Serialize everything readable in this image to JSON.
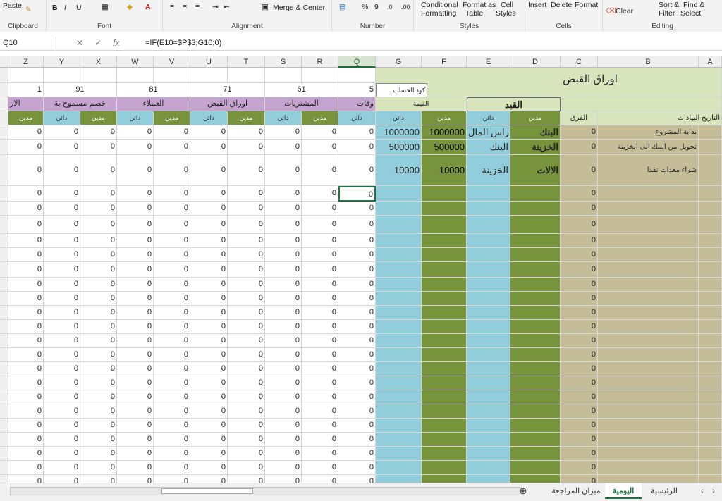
{
  "ribbon": {
    "clipboard": {
      "paste": "Paste",
      "label": "Clipboard"
    },
    "font": {
      "bold": "B",
      "italic": "I",
      "underline": "U",
      "label": "Font"
    },
    "alignment": {
      "merge": "Merge & Center",
      "label": "Alignment"
    },
    "number": {
      "percent": "%",
      "comma": "9",
      "label": "Number"
    },
    "styles": {
      "cond1": "Conditional",
      "cond2": "Formatting",
      "fmt1": "Format as",
      "fmt2": "Table",
      "cs1": "Cell",
      "cs2": "Styles",
      "label": "Styles"
    },
    "cells": {
      "insert": "Insert",
      "delete": "Delete",
      "format": "Format",
      "label": "Cells"
    },
    "editing": {
      "clear": "Clear",
      "sort1": "Sort &",
      "sort2": "Filter",
      "find1": "Find &",
      "find2": "Select",
      "label": "Editing"
    }
  },
  "formula_bar": {
    "name_box": "Q10",
    "fx": "fx",
    "formula": "=IF(E10=$P$3;G10;0)"
  },
  "columns": [
    "Z",
    "Y",
    "X",
    "W",
    "V",
    "U",
    "T",
    "S",
    "R",
    "Q",
    "G",
    "F",
    "E",
    "D",
    "C",
    "B",
    "A"
  ],
  "header": {
    "title": "اوراق القبض",
    "account_code": "كود الحساب",
    "codes": [
      "1",
      "91",
      "81",
      "71",
      "61",
      "5"
    ],
    "groups": [
      "الار",
      "خصم مسموح بة",
      "العملاء",
      "اوراق القبض",
      "المشتريات",
      "وفات"
    ],
    "qayd": "القيد",
    "value": "القيمة",
    "dr": "مدين",
    "cr": "دائن",
    "diff": "الفرق",
    "statement": "البيادات",
    "date": "التاريخ"
  },
  "entries": [
    {
      "b": "بداية المشروع",
      "c": "0",
      "d": "البنك",
      "e": "راس المال",
      "f": "1000000",
      "g": "1000000"
    },
    {
      "b": "تحويل من البنك الى الخزينة",
      "c": "0",
      "d": "الخزينة",
      "e": "البنك",
      "f": "500000",
      "g": "500000"
    },
    {
      "b": "شراء معدات نقدا",
      "c": "0",
      "d": "الالات",
      "e": "الخزينة",
      "f": "10000",
      "g": "10000"
    }
  ],
  "zero": "0",
  "tabs": {
    "review": "ميزان المراجعة",
    "journal": "اليومية",
    "main": "الرئيسية"
  }
}
